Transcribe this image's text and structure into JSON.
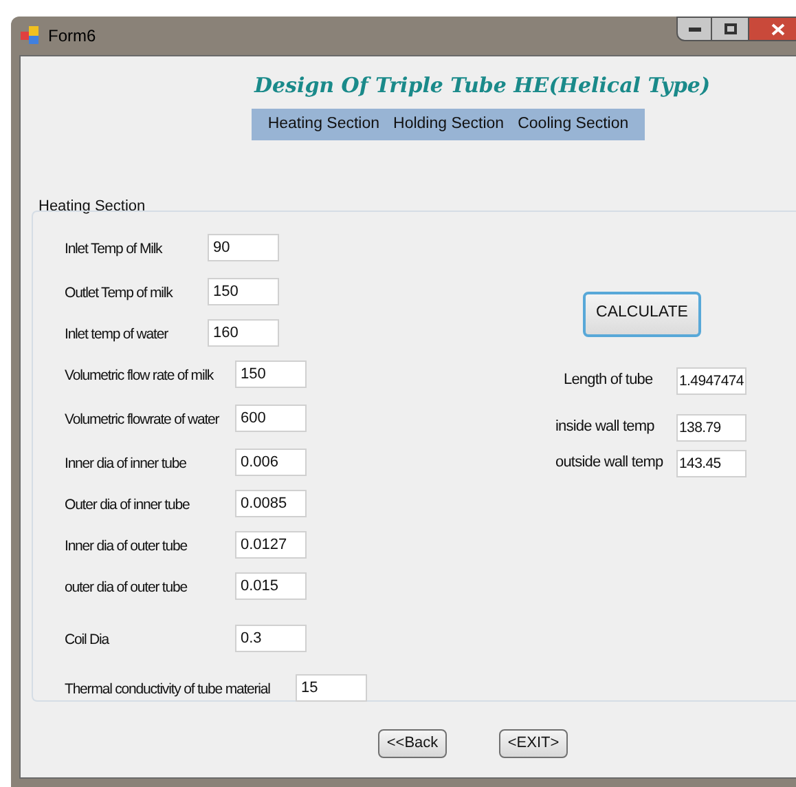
{
  "window": {
    "title": "Form6"
  },
  "heading": "Design Of Triple Tube HE(Helical Type)",
  "menu": [
    "Heating Section",
    "Holding Section",
    "Cooling Section"
  ],
  "group": {
    "title": "Heating Section",
    "fields": [
      {
        "label": "Inlet Temp of Milk",
        "value": "90"
      },
      {
        "label": "Outlet Temp of milk",
        "value": "150"
      },
      {
        "label": "Inlet temp of water",
        "value": "160"
      },
      {
        "label": "Volumetric flow rate of milk",
        "value": "150"
      },
      {
        "label": "Volumetric flowrate of water",
        "value": "600"
      },
      {
        "label": "Inner dia of inner tube",
        "value": "0.006"
      },
      {
        "label": "Outer dia of inner tube",
        "value": "0.0085"
      },
      {
        "label": "Inner dia of outer tube",
        "value": "0.0127"
      },
      {
        "label": "outer dia of outer tube",
        "value": "0.015"
      },
      {
        "label": "Coil Dia",
        "value": "0.3"
      },
      {
        "label": "Thermal conductivity of tube material",
        "value": "15"
      }
    ],
    "calculate": "CALCULATE",
    "results": [
      {
        "label": "Length of tube",
        "value": "1.4947474"
      },
      {
        "label": "inside wall temp",
        "value": "138.79"
      },
      {
        "label": "outside wall temp",
        "value": "143.45"
      }
    ]
  },
  "buttons": [
    "<<Back",
    "<EXIT>"
  ]
}
